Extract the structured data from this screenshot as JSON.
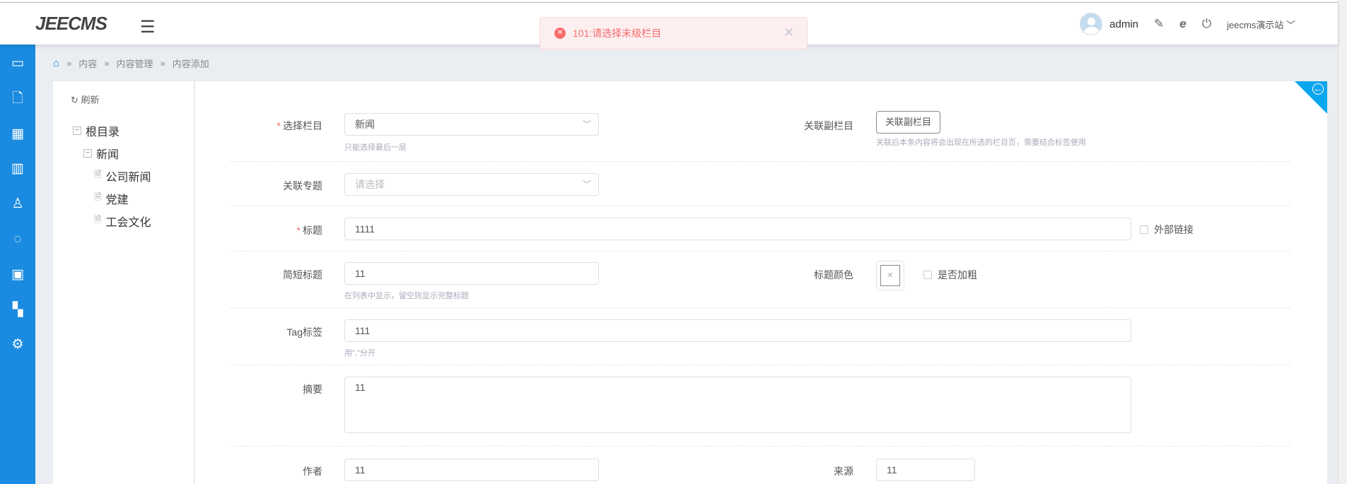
{
  "header": {
    "logo": "JEECMS",
    "user": "admin",
    "site": "jeecms演示站"
  },
  "toast": {
    "message": "101:请选择末级栏目"
  },
  "breadcrumb": [
    "内容",
    "内容管理",
    "内容添加"
  ],
  "tree": {
    "refresh": "刷新",
    "root": "根目录",
    "news": "新闻",
    "children": [
      "公司新闻",
      "党建",
      "工会文化"
    ]
  },
  "form": {
    "channel": {
      "label": "选择栏目",
      "value": "新闻",
      "hint": "只能选择最后一层"
    },
    "sub_channel": {
      "label": "关联副栏目",
      "button": "关联副栏目",
      "hint": "关联后本条内容将会出现在所选的栏目页，需要结合标签使用"
    },
    "topic": {
      "label": "关联专题",
      "placeholder": "请选择"
    },
    "title": {
      "label": "标题",
      "value": "1111",
      "external_link": "外部链接"
    },
    "short_title": {
      "label": "简短标题",
      "value": "11",
      "hint": "在列表中显示，留空则显示完整标题"
    },
    "title_color": {
      "label": "标题颜色",
      "bold": "是否加粗"
    },
    "tags": {
      "label": "Tag标签",
      "value": "111",
      "hint": "用\",\"分开"
    },
    "summary": {
      "label": "摘要",
      "value": "11"
    },
    "author": {
      "label": "作者",
      "value": "11"
    },
    "source": {
      "label": "来源",
      "value": "11"
    }
  }
}
